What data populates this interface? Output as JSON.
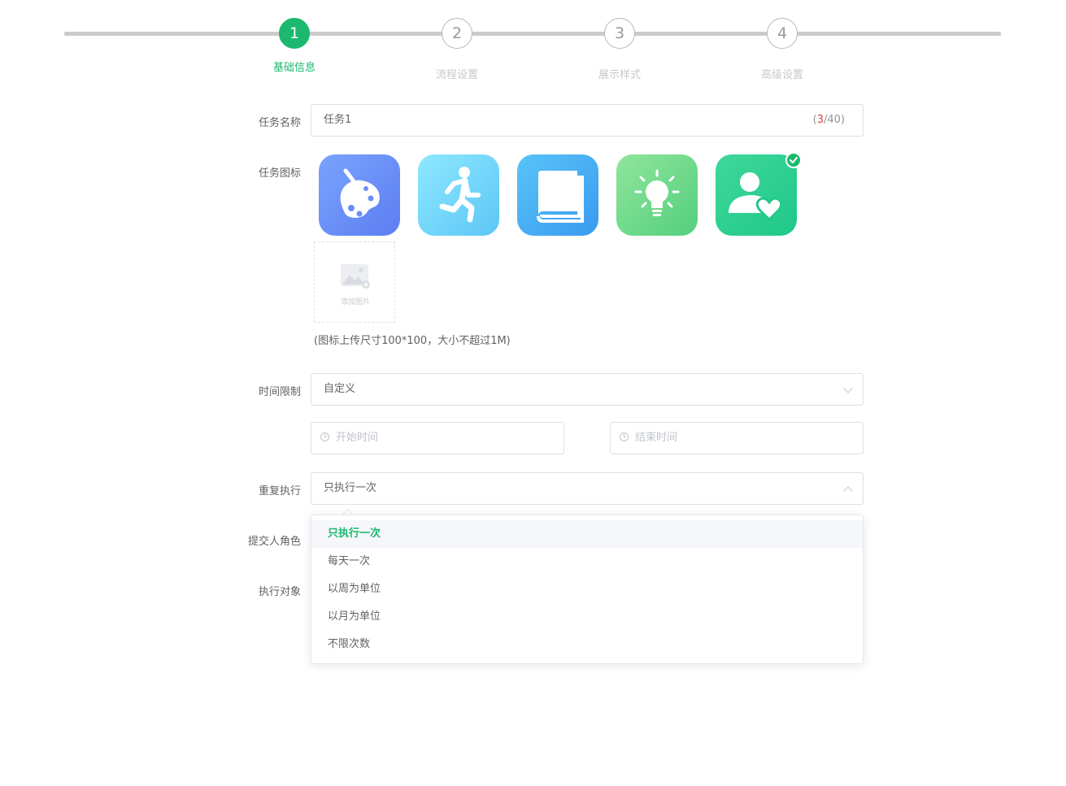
{
  "steps": [
    {
      "number": "1",
      "label": "基础信息",
      "active": true
    },
    {
      "number": "2",
      "label": "流程设置",
      "active": false
    },
    {
      "number": "3",
      "label": "展示样式",
      "active": false
    },
    {
      "number": "4",
      "label": "高级设置",
      "active": false
    }
  ],
  "form": {
    "task_name": {
      "label": "任务名称",
      "value": "任务1",
      "count_open": "(",
      "count_current": "3",
      "count_rest": "/40)"
    },
    "task_icon": {
      "label": "任务图标",
      "icons": [
        "palette-icon",
        "running-person-icon",
        "book-icon",
        "lightbulb-icon",
        "user-heart-icon"
      ],
      "selected_index": 4,
      "upload_label": "添加图片",
      "hint": "(图标上传尺寸100*100，大小不超过1M)"
    },
    "time_limit": {
      "label": "时间限制",
      "value": "自定义",
      "start_placeholder": "开始时间",
      "end_placeholder": "结束时间"
    },
    "repeat": {
      "label": "重复执行",
      "value": "只执行一次"
    },
    "submitter_role": {
      "label": "提交人角色"
    },
    "target": {
      "label": "执行对象"
    }
  },
  "dropdown": {
    "options": [
      "只执行一次",
      "每天一次",
      "以周为单位",
      "以月为单位",
      "不限次数"
    ],
    "selected_index": 0
  },
  "colors": {
    "accent": "#1cb86f",
    "border": "#dcdfe6",
    "text": "#606266",
    "placeholder": "#c0c4cc"
  }
}
